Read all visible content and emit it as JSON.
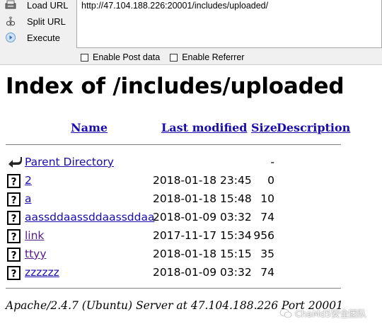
{
  "hackbar": {
    "actions": [
      {
        "label": "Load URL",
        "icon": "load-url-icon"
      },
      {
        "label": "Split URL",
        "icon": "split-url-icon"
      },
      {
        "label": "Execute",
        "icon": "execute-icon"
      }
    ],
    "url": "http://47.104.188.226:20001/includes/uploaded/",
    "options": [
      {
        "label": "Enable Post data",
        "checked": false
      },
      {
        "label": "Enable Referrer",
        "checked": false
      }
    ]
  },
  "page": {
    "title": "Index of /includes/uploaded",
    "columns": {
      "name": "Name",
      "last_modified": "Last modified",
      "size": "Size",
      "description": "Description"
    },
    "parent": {
      "name": "Parent Directory",
      "size": "-",
      "icon": "back-arrow-icon"
    },
    "files": [
      {
        "name": "2",
        "date": "2018-01-18 23:45",
        "size": "0",
        "icon": "unknown-file-icon",
        "visited": false
      },
      {
        "name": "a",
        "date": "2018-01-18 15:48",
        "size": "10",
        "icon": "unknown-file-icon",
        "visited": false
      },
      {
        "name": "aassddaassddaassddaa",
        "date": "2018-01-09 03:32",
        "size": "74",
        "icon": "unknown-file-icon",
        "visited": false
      },
      {
        "name": "link",
        "date": "2017-11-17 15:34",
        "size": "956",
        "icon": "unknown-file-icon",
        "visited": true
      },
      {
        "name": "ttyy",
        "date": "2018-01-18 15:15",
        "size": "35",
        "icon": "unknown-file-icon",
        "visited": true
      },
      {
        "name": "zzzzzz",
        "date": "2018-01-09 03:32",
        "size": "74",
        "icon": "unknown-file-icon",
        "visited": false
      }
    ],
    "footer": "Apache/2.4.7 (Ubuntu) Server at 47.104.188.226 Port 20001"
  },
  "watermark": {
    "text": "ChaMd5安全团队"
  },
  "colors": {
    "link": "#1a0dab",
    "visited": "#551a8b",
    "toolbar_bg": "#f0f0f0"
  }
}
